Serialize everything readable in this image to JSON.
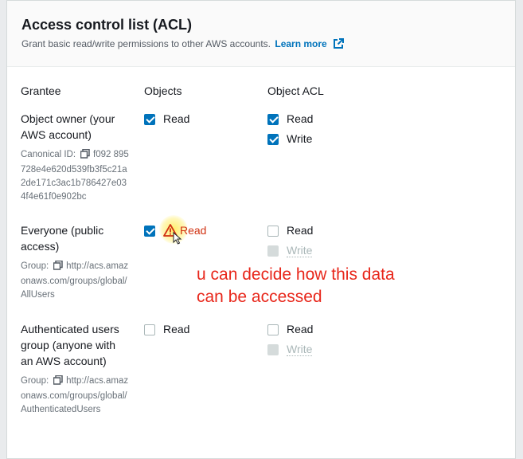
{
  "header": {
    "title": "Access control list (ACL)",
    "description": "Grant basic read/write permissions to other AWS accounts.",
    "learn_more": "Learn more"
  },
  "columns": {
    "grantee": "Grantee",
    "objects": "Objects",
    "object_acl": "Object ACL"
  },
  "rows": {
    "owner": {
      "name": "Object owner (your AWS account)",
      "id_label": "Canonical ID:",
      "id_value": "f092 895728e4e620d539fb3f5c21a2de171c3ac1b786427e034f4e61f0e902bc",
      "objects_read": "Read",
      "acl_read": "Read",
      "acl_write": "Write"
    },
    "everyone": {
      "name": "Everyone (public access)",
      "group_label": "Group:",
      "group_value": "http://acs.amazonaws.com/groups/global/AllUsers",
      "objects_read": "Read",
      "acl_read": "Read",
      "acl_write": "Write"
    },
    "authenticated": {
      "name": "Authenticated users group (anyone with an AWS account)",
      "group_label": "Group:",
      "group_value": "http://acs.amazonaws.com/groups/global/AuthenticatedUsers",
      "objects_read": "Read",
      "acl_read": "Read",
      "acl_write": "Write"
    }
  },
  "annotation": {
    "line1": "u can decide how this data",
    "line2": "can be accessed"
  },
  "colors": {
    "accent": "#0073bb",
    "warning": "#d13212",
    "annotation": "#e8271b"
  }
}
